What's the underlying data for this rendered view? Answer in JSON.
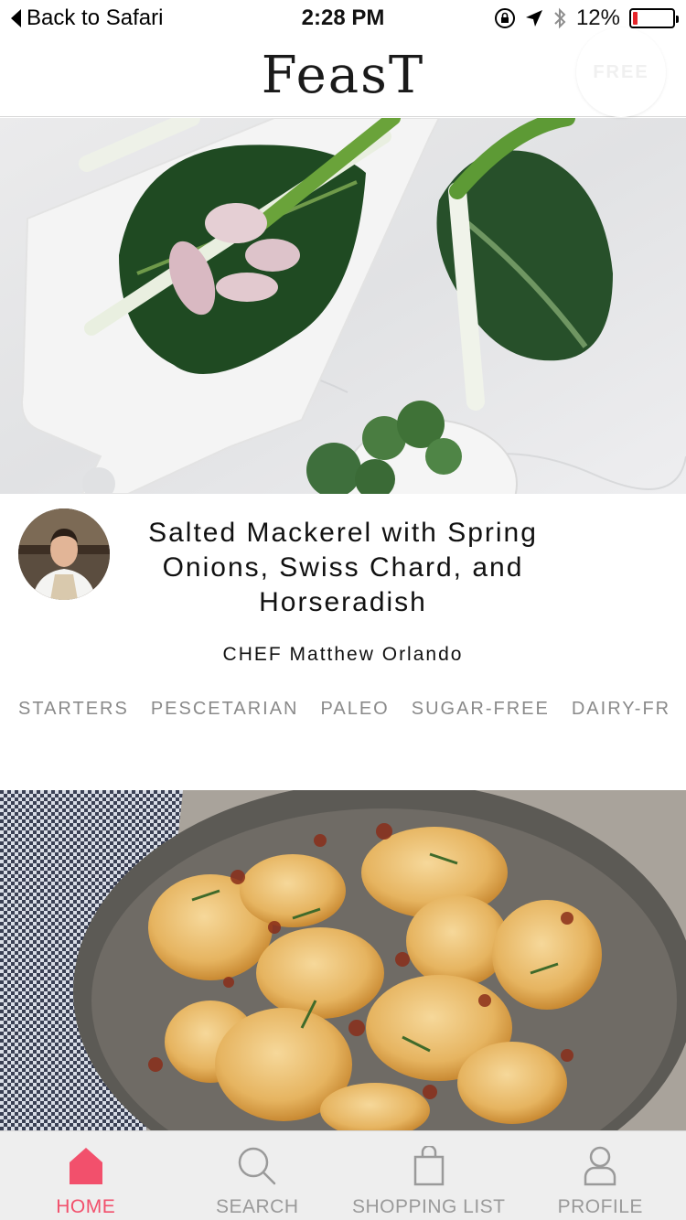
{
  "status_bar": {
    "back_label": "Back to Safari",
    "time": "2:28 PM",
    "battery_percent": "12%",
    "battery_level": 0.12,
    "icons": [
      "orientation-lock-icon",
      "location-arrow-icon",
      "bluetooth-icon",
      "battery-icon"
    ]
  },
  "header": {
    "logo_text": "Feast",
    "badge_text": "FREE"
  },
  "recipe": {
    "title": "Salted Mackerel with Spring Onions, Swiss Chard, and Horseradish",
    "chef_line": "CHEF Matthew Orlando",
    "tags": [
      "STARTERS",
      "PESCETARIAN",
      "PALEO",
      "SUGAR-FREE",
      "DAIRY-FR"
    ]
  },
  "tab_bar": {
    "tabs": [
      {
        "label": "HOME",
        "icon": "home-icon",
        "active": true
      },
      {
        "label": "SEARCH",
        "icon": "search-icon",
        "active": false
      },
      {
        "label": "SHOPPING LIST",
        "icon": "shopping-bag-icon",
        "active": false
      },
      {
        "label": "PROFILE",
        "icon": "profile-icon",
        "active": false
      }
    ]
  },
  "colors": {
    "accent": "#f2506c",
    "tag_text": "#8a8a8a",
    "tab_inactive": "#9a9a9a",
    "battery_low": "#e5252a"
  }
}
